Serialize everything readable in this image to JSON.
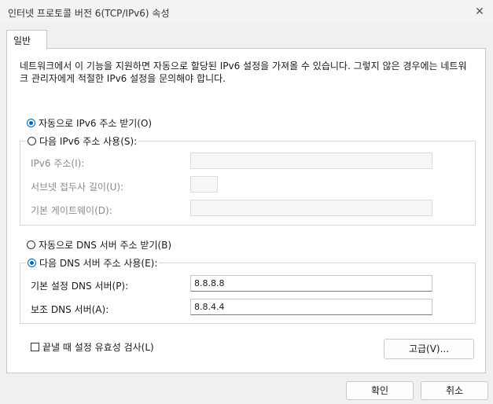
{
  "window": {
    "title": "인터넷 프로토콜 버전 6(TCP/IPv6) 속성",
    "close_glyph": "✕"
  },
  "tab": {
    "label": "일반"
  },
  "description": "네트워크에서 이 기능을 지원하면 자동으로 할당된 IPv6 설정을 가져올 수 있습니다. 그렇지 않은 경우에는 네트워크 관리자에게 적절한 IPv6 설정을 문의해야 합니다.",
  "ip_section": {
    "auto_label": "자동으로 IPv6 주소 받기(O)",
    "auto_selected": true,
    "manual_label": "다음 IPv6 주소 사용(S):",
    "fields": {
      "address_label": "IPv6 주소(I):",
      "prefix_label": "서브넷 접두사 길이(U):",
      "gateway_label": "기본 게이트웨이(D):"
    }
  },
  "dns_section": {
    "auto_label": "자동으로 DNS 서버 주소 받기(B)",
    "manual_label": "다음 DNS 서버 주소 사용(E):",
    "manual_selected": true,
    "preferred_label": "기본 설정 DNS 서버(P):",
    "preferred_value": "8.8.8.8",
    "alternate_label": "보조 DNS 서버(A):",
    "alternate_value": "8.8.4.4"
  },
  "validate_label": "끝낼 때 설정 유효성 검사(L)",
  "validate_checked": false,
  "buttons": {
    "advanced": "고급(V)...",
    "ok": "확인",
    "cancel": "취소"
  }
}
